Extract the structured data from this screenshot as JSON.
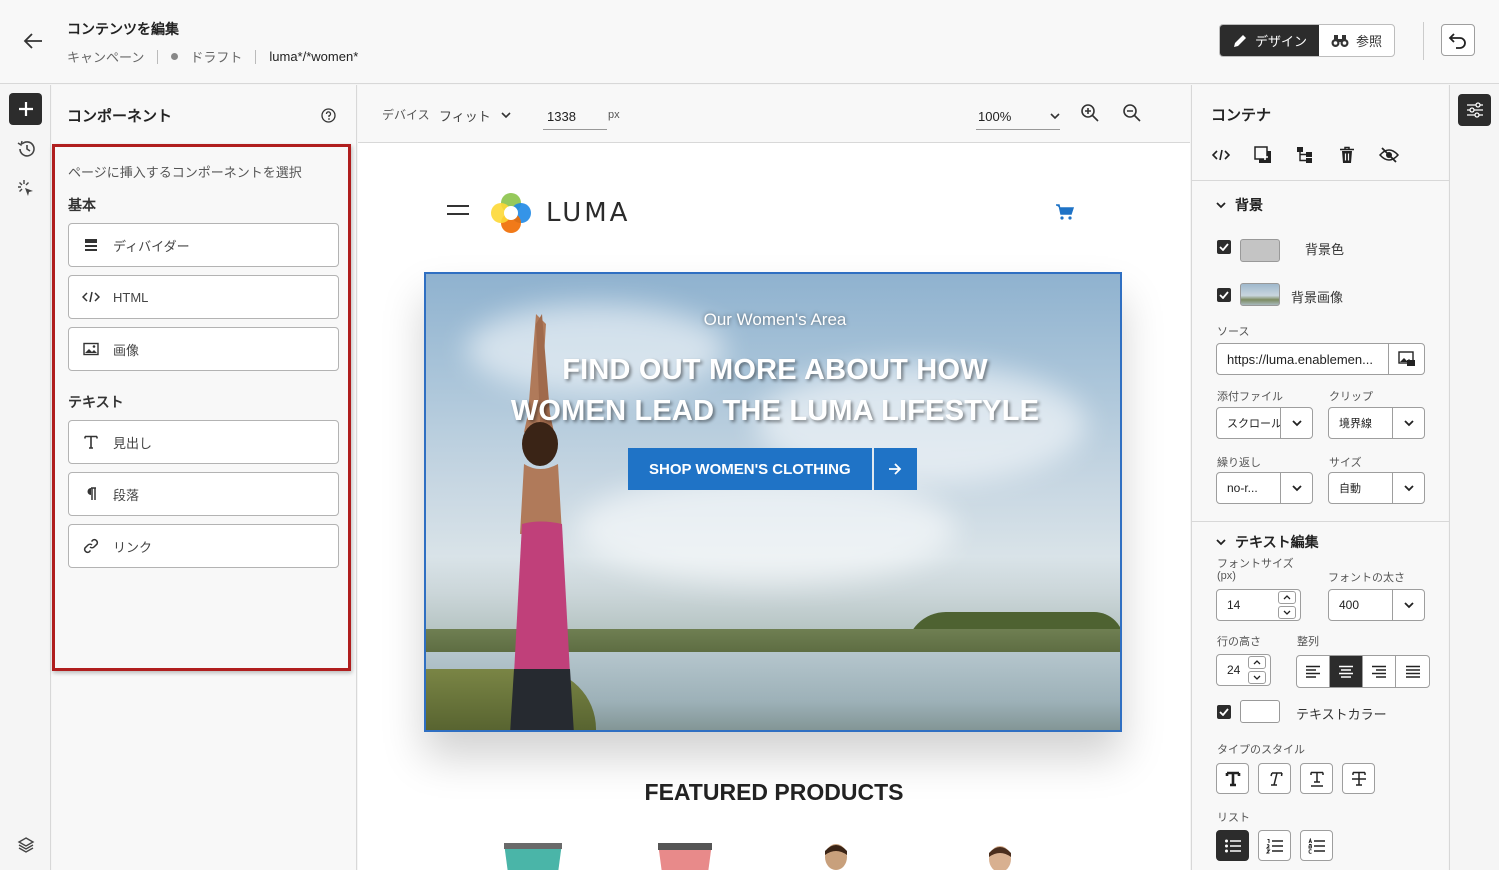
{
  "header": {
    "title": "コンテンツを編集",
    "breadcrumb_campaign": "キャンペーン",
    "breadcrumb_status": "ドラフト",
    "breadcrumb_target": "luma*/*women*",
    "design_label": "デザイン",
    "browse_label": "参照"
  },
  "components": {
    "title": "コンポーネント",
    "description": "ページに挿入するコンポーネントを選択",
    "section_basic": "基本",
    "section_text": "テキスト",
    "items": [
      "ディバイダー",
      "HTML",
      "画像",
      "見出し",
      "段落",
      "リンク"
    ]
  },
  "toolbar": {
    "device_label": "デバイス",
    "device_value": "フィット",
    "width_value": "1338",
    "width_unit": "px",
    "zoom_value": "100%"
  },
  "page": {
    "logo_text": "LUMA",
    "hero_subtitle": "Our Women's Area",
    "hero_title_line1": "FIND OUT MORE ABOUT HOW",
    "hero_title_line2": "WOMEN LEAD THE LUMA LIFESTYLE",
    "hero_cta": "SHOP WOMEN'S CLOTHING",
    "featured_heading": "FEATURED PRODUCTS"
  },
  "container": {
    "title": "コンテナ",
    "background": {
      "section_label": "背景",
      "color_label": "背景色",
      "color_value": "#c4c4c4",
      "image_label": "背景画像",
      "source_label": "ソース",
      "source_value": "https://luma.enablemen...",
      "attachment_label": "添付ファイル",
      "attachment_value": "スクロール",
      "clip_label": "クリップ",
      "clip_value": "境界線",
      "repeat_label": "繰り返し",
      "repeat_value": "no-r...",
      "size_label": "サイズ",
      "size_value": "自動"
    },
    "text_edit": {
      "section_label": "テキスト編集",
      "font_size_label_1": "フォントサイズ",
      "font_size_label_2": "(px)",
      "font_size_value": "14",
      "font_weight_label": "フォントの太さ",
      "font_weight_value": "400",
      "line_height_label": "行の高さ",
      "line_height_value": "24",
      "alignment_label": "整列",
      "text_color_label": "テキストカラー",
      "text_color_value": "#ffffff",
      "type_style_label": "タイプのスタイル",
      "list_label": "リスト"
    }
  },
  "colors": {
    "accent_dark": "#2c2c2c",
    "brand_blue": "#1f73c6",
    "highlight_red": "#b01e1e"
  }
}
